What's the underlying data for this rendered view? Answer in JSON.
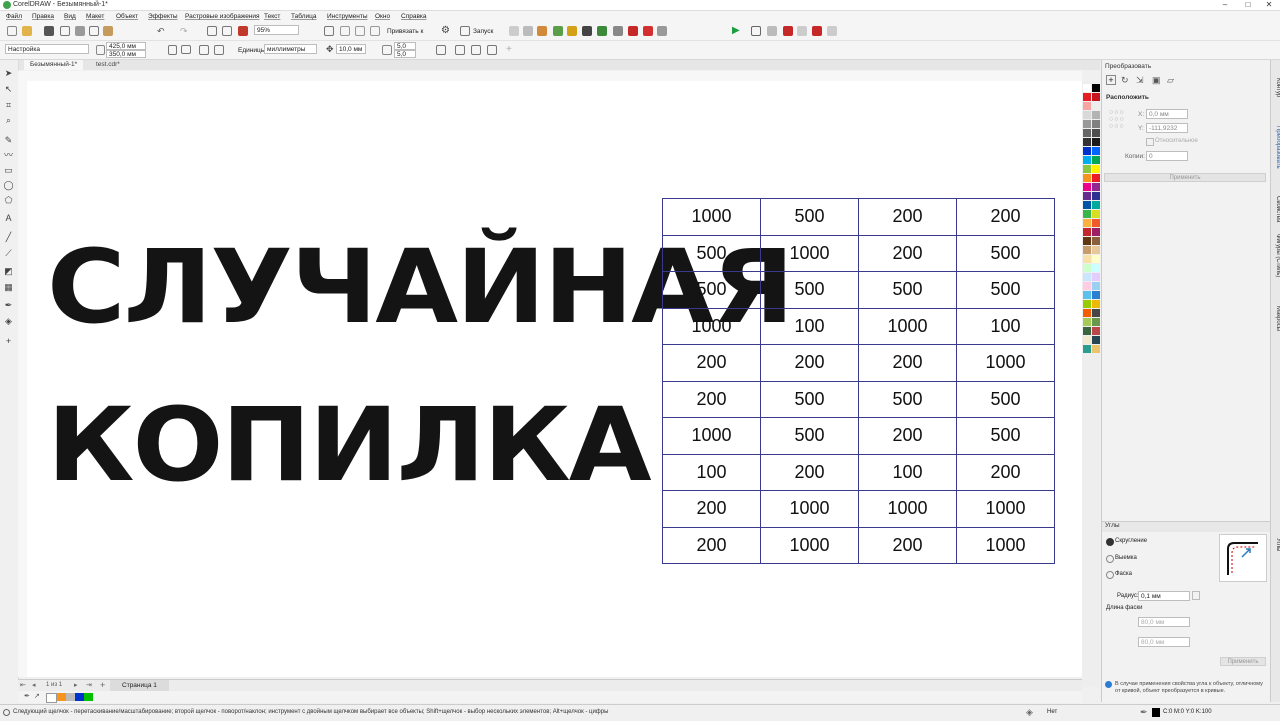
{
  "window": {
    "title": "CorelDRAW - Безымянный-1*"
  },
  "menu": [
    "Файл",
    "Правка",
    "Вид",
    "Макет",
    "Объект",
    "Эффекты",
    "Растровые изображения",
    "Текст",
    "Таблица",
    "Инструменты",
    "Окно",
    "Справка"
  ],
  "toolbar1": {
    "zoom": "95%",
    "snap": "Привязать к",
    "launch": "Запуск"
  },
  "toolbar2": {
    "preset": "Настройка",
    "width": "425,0 мм",
    "height": "350,0 мм",
    "units_label": "Единицы:",
    "units": "миллиметры",
    "nudge": "10,0 мм",
    "dup_x": "5,0 мм",
    "dup_y": "5,0 мм"
  },
  "doc_tabs": [
    "Безымянный-1*",
    "test.cdr*"
  ],
  "canvas": {
    "headline1": "СЛУЧАЙНАЯ",
    "headline2": "КОПИЛКА",
    "table": [
      [
        "1000",
        "500",
        "200",
        "200"
      ],
      [
        "500",
        "1000",
        "200",
        "500"
      ],
      [
        "500",
        "500",
        "500",
        "500"
      ],
      [
        "1000",
        "100",
        "1000",
        "100"
      ],
      [
        "200",
        "200",
        "200",
        "1000"
      ],
      [
        "200",
        "500",
        "500",
        "500"
      ],
      [
        "1000",
        "500",
        "200",
        "500"
      ],
      [
        "100",
        "200",
        "100",
        "200"
      ],
      [
        "200",
        "1000",
        "1000",
        "1000"
      ],
      [
        "200",
        "1000",
        "200",
        "1000"
      ]
    ]
  },
  "transform_panel": {
    "title": "Преобразовать",
    "section": "Расположить",
    "x_label": "X:",
    "x_value": "0,0 мм",
    "y_label": "Y:",
    "y_value": "-111,9232",
    "relative": "Относительное",
    "copies_label": "Копии:",
    "copies_value": "0",
    "apply": "Применить"
  },
  "corners_panel": {
    "title": "Углы",
    "options": [
      "Скругление",
      "Выемка",
      "Фаска"
    ],
    "radius_label": "Радиус:",
    "radius_value": "0,1 мм",
    "chamfer_label": "Длина фаски",
    "chamfer_a": "80,0 мм",
    "chamfer_b": "80,0 мм",
    "apply": "Применить",
    "hint": "В случае применения свойства угла к объекту, отличному от кривой, объект преобразуется в кривые."
  },
  "dock_tabs": [
    "Контур",
    "Преобразовать",
    "Свойства",
    "Фигуры (Стиль)",
    "Макросы",
    "Углы"
  ],
  "page_nav": {
    "counter": "1 из 1",
    "page_tab": "Страница 1"
  },
  "status": {
    "hint": "Следующий щелчок - перетаскивание/масштабирование; второй щелчок - поворот/наклон; инструмент с двойным щелчком выбирает все объекты; Shift+щелчок - выбор нескольких элементов; Alt+щелчок - цифры",
    "fill": "Нет",
    "color": "C:0 M:0 Y:0 K:100"
  },
  "palette": [
    "#ffffff",
    "#000000",
    "#e31e24",
    "#c4161c",
    "#f7a4a4",
    "#ededed",
    "#d9d9d9",
    "#b3b3b3",
    "#999999",
    "#808080",
    "#666666",
    "#4d4d4d",
    "#333333",
    "#1a1a1a",
    "#0033cc",
    "#0066ff",
    "#00aeef",
    "#00a651",
    "#8dc63f",
    "#fff200",
    "#f7941d",
    "#ed1c24",
    "#ec008c",
    "#92278f",
    "#662d91",
    "#2e3192",
    "#0054a6",
    "#00a99d",
    "#39b54a",
    "#d7df23",
    "#fbb040",
    "#f15a29",
    "#c1272d",
    "#9e1f63",
    "#603913",
    "#8b5e3c",
    "#c69c6d",
    "#e6c89b",
    "#f9e0a8",
    "#ffffcc",
    "#ccffcc",
    "#ccffff",
    "#cce5ff",
    "#e5ccff",
    "#ffcce5",
    "#9ad1f0",
    "#5bc0eb",
    "#2d7dd2",
    "#97cc04",
    "#eeb902",
    "#f45d01",
    "#474647",
    "#a7c957",
    "#6a994e",
    "#386641",
    "#bc4749",
    "#f2e8cf",
    "#264653",
    "#2a9d8f",
    "#e9c46a"
  ]
}
